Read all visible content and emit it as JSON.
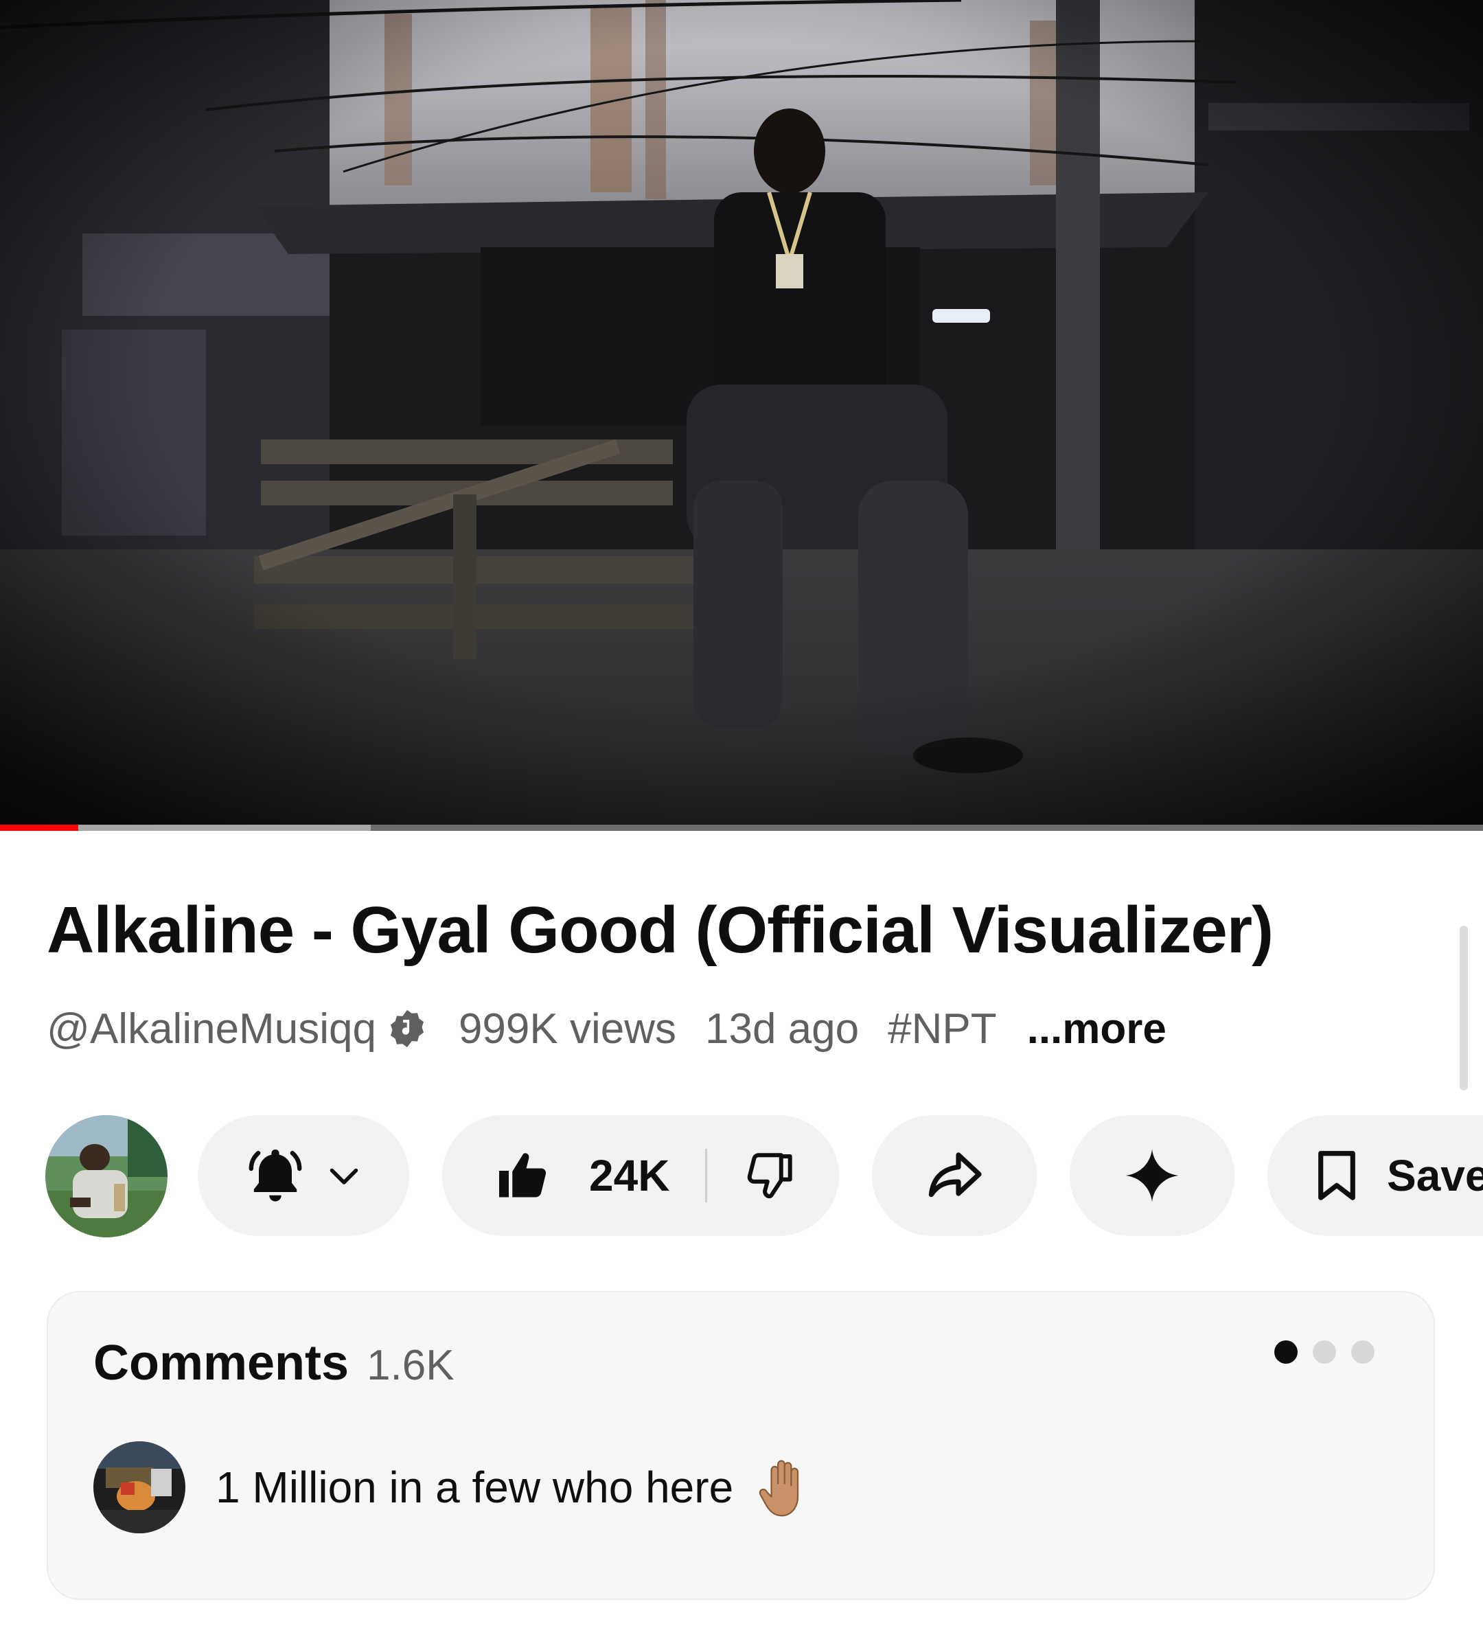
{
  "video": {
    "title": "Alkaline - Gyal Good (Official Visualizer)",
    "progress_played": 0.053,
    "progress_buffered": 0.25
  },
  "meta": {
    "channel_handle": "@AlkalineMusiqq",
    "verified_icon": "music-note-verified-icon",
    "views": "999K views",
    "age": "13d ago",
    "hashtag": "#NPT",
    "more_label": "...more"
  },
  "actions": {
    "subscribe_icon": "bell-icon",
    "likes": "24K",
    "save_label": "Save",
    "share_icon": "share-arrow-icon",
    "ask_icon": "sparkle-icon"
  },
  "comments": {
    "title": "Comments",
    "count": "1.6K",
    "top_comment": {
      "text": "1 Million in a few who here",
      "emoji_icon": "raised-hand-icon"
    },
    "page_dots": 3,
    "active_dot": 0
  },
  "colors": {
    "progress_red": "#ff0000",
    "pill_bg": "#f2f2f2",
    "card_bg": "#f7f7f7",
    "secondary_text": "#606060"
  }
}
